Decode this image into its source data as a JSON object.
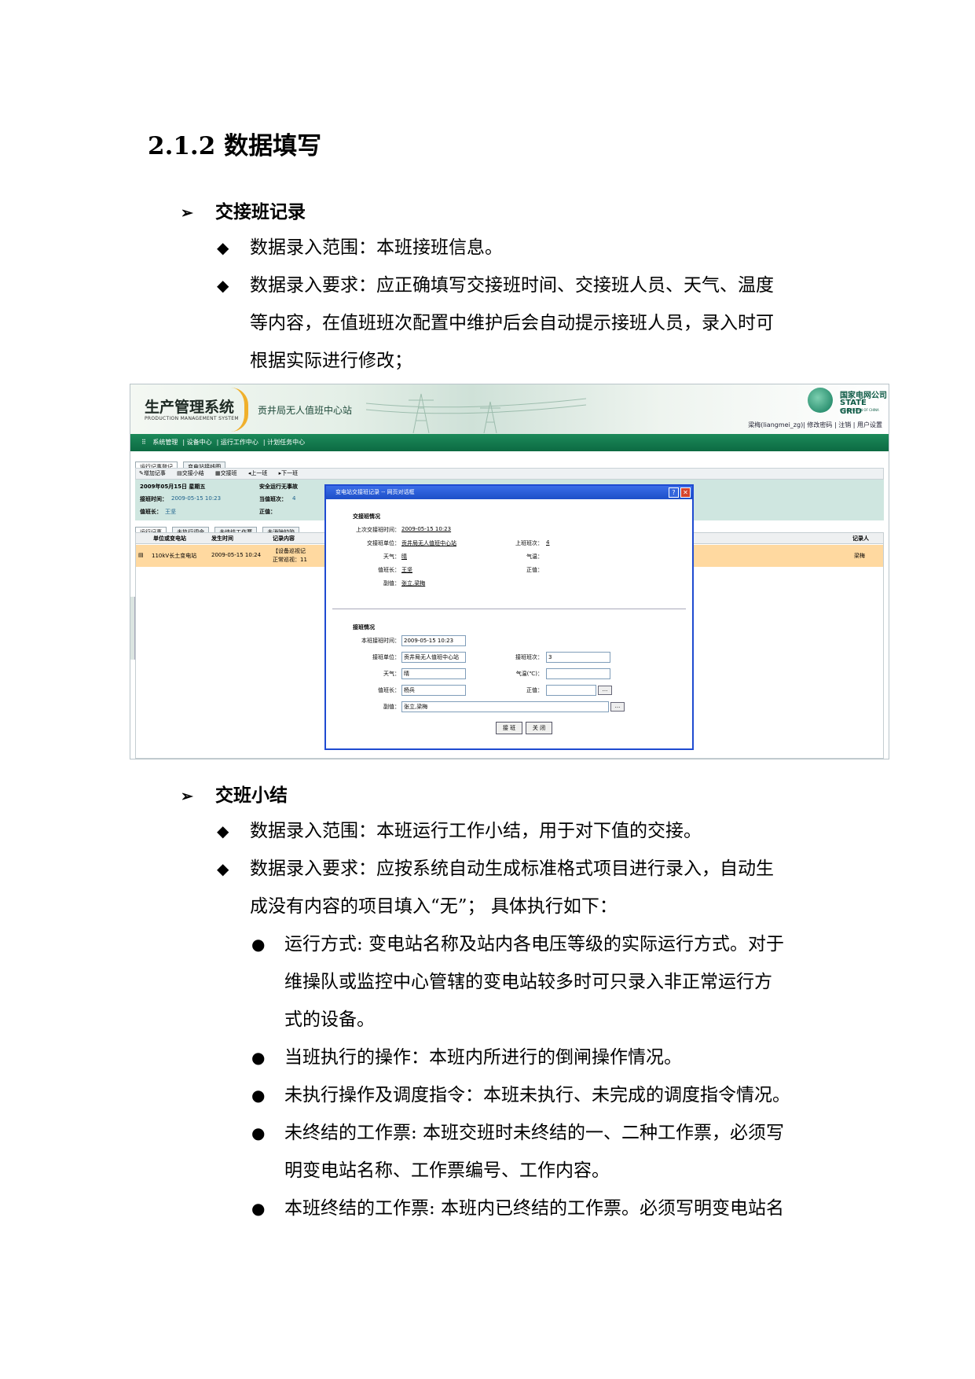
{
  "doc": {
    "heading": "2.1.2 数据填写",
    "section1": {
      "title": "交接班记录",
      "bullets": [
        "数据录入范围：本班接班信息。",
        "数据录入要求：应正确填写交接班时间、交接班人员、天气、温度",
        "等内容，在值班班次配置中维护后会自动提示接班人员，录入时可",
        "根据实际进行修改；"
      ]
    },
    "section2": {
      "title": "交班小结",
      "bullets": [
        "数据录入范围：本班运行工作小结，用于对下值的交接。",
        "数据录入要求：应按系统自动生成标准格式项目进行录入，自动生",
        "成没有内容的项目填入“无”；  具体执行如下："
      ],
      "items": [
        "运行方式: 变电站名称及站内各电压等级的实际运行方式。对于",
        "维操队或监控中心管辖的变电站较多时可只录入非正常运行方",
        "式的设备。",
        "当班执行的操作：本班内所进行的倒闸操作情况。",
        "未执行操作及调度指令：本班未执行、未完成的调度指令情况。",
        "未终结的工作票: 本班交班时未终结的一、二种工作票，必须写",
        "明变电站名称、工作票编号、工作内容。",
        "本班终结的工作票: 本班内已终结的工作票。必须写明变电站名"
      ]
    }
  },
  "app": {
    "title": "生产管理系统",
    "subtitle": "PRODUCTION MANAGEMENT SYSTEM",
    "station": "贡井局无人值班中心站",
    "brand_cn": "国家电网公司",
    "brand_en": "STATE GRID",
    "brand_sub": "CORPORATION OF CHINA",
    "user_links": "梁梅(liangmei_zg)| 修改密码 | 注销 | 用户设置",
    "nav": [
      "系统管理",
      "设备中心",
      "运行工作中心",
      "计划任务中心"
    ],
    "tabs_top": [
      "运行记事登记",
      "变电站接线图"
    ],
    "toolbar": [
      "增加记事",
      "交接小结",
      "交接班",
      "上一班",
      "下一班"
    ],
    "info": {
      "date": "2009年05月15日 星期五",
      "safe": "安全运行无事故",
      "jiaoban_label": "接班时间：",
      "jiaoban_time": "2009-05-15 10:23",
      "dangzhi_label": "当值班次：",
      "dangzhi_val": "4",
      "leader_label": "值班长：",
      "leader_val": "王坚",
      "zhengzhi_label": "正值："
    },
    "tabs_bottom": [
      "运行记事",
      "未执行调令",
      "未终结工作票",
      "未消除缺陷"
    ],
    "grid": {
      "headers": [
        "单位或变电站",
        "发生时间",
        "记录内容",
        "记录人"
      ],
      "row": {
        "station": "110kV长土变电站",
        "time": "2009-05-15 10:24",
        "content1": "【设备巡视记",
        "content2": "正常巡视：11",
        "recorder": "梁梅"
      }
    }
  },
  "dialog": {
    "title": "变电站交接班记录 -- 网页对话框",
    "handover_section": "交接班情况",
    "last_time_label": "上次交接班时间：",
    "last_time": "2009-05-15 10:23",
    "unit_label": "交接班单位：",
    "unit": "贡井局无人值班中心站",
    "prev_shift_label": "上班班次：",
    "prev_shift": "4",
    "weather_label": "天气：",
    "weather": "晴",
    "temp_label": "气温：",
    "leader_label": "值班长：",
    "leader": "王坚",
    "zheng_label": "正值：",
    "fu_label": "副值：",
    "fu": "张立,梁梅",
    "take_section": "接班情况",
    "this_time_label": "本班接班时间：",
    "this_time": "2009-05-15 10:23",
    "take_unit_label": "接班单位：",
    "take_unit": "贡井局无人值班中心站",
    "take_shift_label": "接班班次：",
    "take_shift": "3",
    "take_weather_label": "天气：",
    "take_weather": "晴",
    "take_temp_label": "气温(℃)：",
    "take_leader_label": "值班长：",
    "take_leader": "杨兵",
    "take_zheng_label": "正值：",
    "take_fu_label": "副值：",
    "take_fu": "张立,梁梅",
    "btn_take": "接 班",
    "btn_close": "关 闭",
    "ellipsis": "..."
  }
}
